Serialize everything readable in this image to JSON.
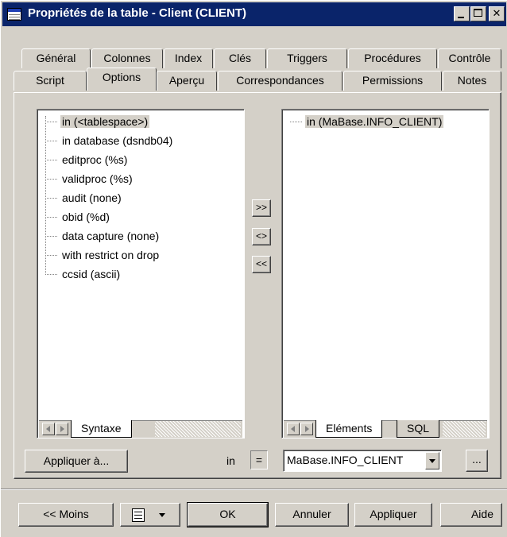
{
  "window": {
    "title": "Propriétés de la table - Client (CLIENT)",
    "icon": "table-icon",
    "controls": {
      "minimize": "",
      "maximize": "",
      "close": "✕"
    }
  },
  "tabs_row1": [
    "Général",
    "Colonnes",
    "Index",
    "Clés",
    "Triggers",
    "Procédures",
    "Contrôle"
  ],
  "tabs_row2": [
    "Script",
    "Options",
    "Aperçu",
    "Correspondances",
    "Permissions",
    "Notes"
  ],
  "active_tab": "Options",
  "syntax_list": {
    "items": [
      "in (<tablespace>)",
      "in database (dsndb04)",
      "editproc (%s)",
      "validproc (%s)",
      "audit (none)",
      "obid (%d)",
      "data capture (none)",
      "with restrict on drop",
      "ccsid (ascii)"
    ],
    "selected_index": 0,
    "sheet_tab": "Syntaxe"
  },
  "move_buttons": {
    "add": ">>",
    "edit": "<>",
    "remove": "<<"
  },
  "elements_list": {
    "items": [
      "in (MaBase.INFO_CLIENT)"
    ],
    "selected_index": 0,
    "sheet_tabs": [
      "Eléments",
      "SQL"
    ]
  },
  "apply_to_button": "Appliquer à...",
  "param_row": {
    "name": "in",
    "operator": "=",
    "value": "MaBase.INFO_CLIENT",
    "more_button": "..."
  },
  "footer": {
    "less_button": "<< Moins",
    "ok": "OK",
    "cancel": "Annuler",
    "apply": "Appliquer",
    "help": "Aide"
  }
}
